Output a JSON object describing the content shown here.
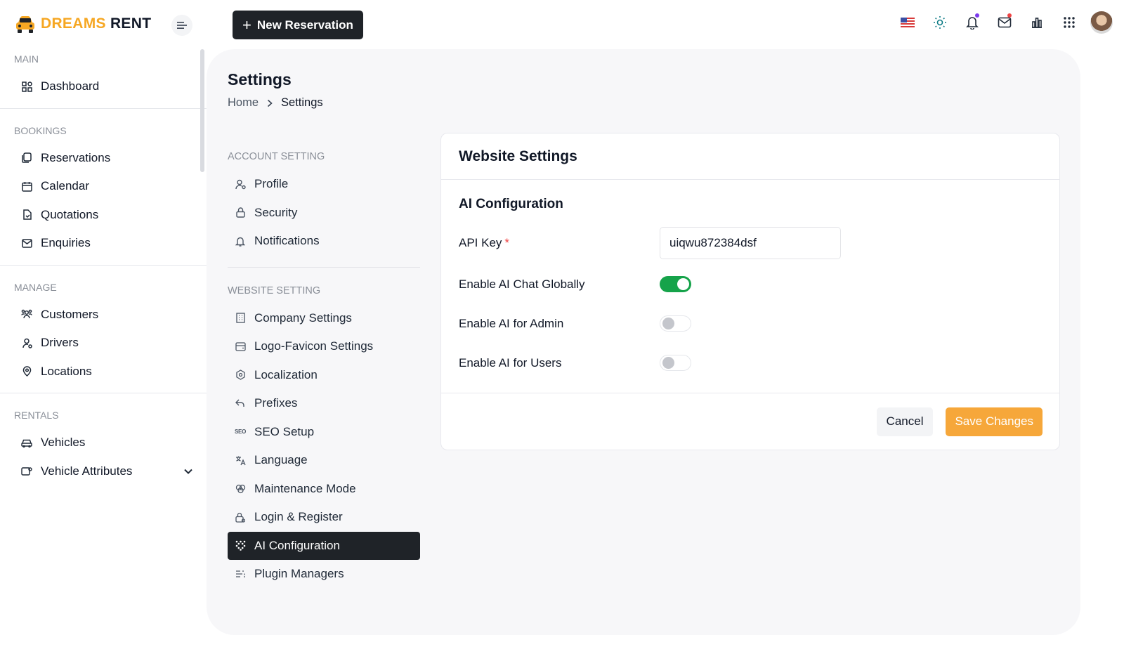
{
  "brand": {
    "name_part1": "DREAMS",
    "name_part2": "RENT",
    "accent": "#f6a723"
  },
  "header": {
    "new_reservation_label": "New Reservation",
    "icons": [
      "us-flag-icon",
      "sun-icon",
      "bell-icon",
      "mail-icon",
      "chart-icon",
      "apps-grid-icon",
      "user-avatar"
    ]
  },
  "sidebar": {
    "sections": [
      {
        "title": "MAIN",
        "items": [
          {
            "label": "Dashboard",
            "icon": "dashboard-icon"
          }
        ]
      },
      {
        "title": "BOOKINGS",
        "items": [
          {
            "label": "Reservations",
            "icon": "reservations-icon"
          },
          {
            "label": "Calendar",
            "icon": "calendar-icon"
          },
          {
            "label": "Quotations",
            "icon": "quotations-icon"
          },
          {
            "label": "Enquiries",
            "icon": "mail-icon"
          }
        ]
      },
      {
        "title": "MANAGE",
        "items": [
          {
            "label": "Customers",
            "icon": "customers-icon"
          },
          {
            "label": "Drivers",
            "icon": "driver-icon"
          },
          {
            "label": "Locations",
            "icon": "location-icon"
          }
        ]
      },
      {
        "title": "RENTALS",
        "items": [
          {
            "label": "Vehicles",
            "icon": "car-icon"
          },
          {
            "label": "Vehicle Attributes",
            "icon": "vehicle-attributes-icon"
          }
        ]
      }
    ]
  },
  "page": {
    "title": "Settings",
    "breadcrumb": {
      "home": "Home",
      "current": "Settings"
    }
  },
  "settings_nav": {
    "account_title": "ACCOUNT SETTING",
    "account_items": [
      {
        "label": "Profile",
        "icon": "profile-icon"
      },
      {
        "label": "Security",
        "icon": "lock-icon"
      },
      {
        "label": "Notifications",
        "icon": "bell-icon"
      }
    ],
    "website_title": "WEBSITE SETTING",
    "website_items": [
      {
        "label": "Company Settings",
        "icon": "building-icon"
      },
      {
        "label": "Logo-Favicon Settings",
        "icon": "image-icon"
      },
      {
        "label": "Localization",
        "icon": "hexagon-icon"
      },
      {
        "label": "Prefixes",
        "icon": "arrow-back-icon"
      },
      {
        "label": "SEO Setup",
        "icon": "seo-icon"
      },
      {
        "label": "Language",
        "icon": "language-icon"
      },
      {
        "label": "Maintenance Mode",
        "icon": "tools-icon"
      },
      {
        "label": "Login & Register",
        "icon": "login-lock-icon"
      },
      {
        "label": "AI Configuration",
        "icon": "ai-sparkle-icon"
      },
      {
        "label": "Plugin Managers",
        "icon": "plugin-icon"
      }
    ],
    "active": "AI Configuration"
  },
  "card": {
    "title": "Website Settings",
    "section_title": "AI Configuration",
    "api_key_label": "API Key",
    "api_key_required": "*",
    "api_key_value": "uiqwu872384dsf",
    "toggles": [
      {
        "label": "Enable AI Chat Globally",
        "on": true
      },
      {
        "label": "Enable AI for Admin",
        "on": false
      },
      {
        "label": "Enable AI for Users",
        "on": false
      }
    ],
    "cancel_label": "Cancel",
    "save_label": "Save Changes",
    "toggle_on_color": "#16a34a",
    "save_color": "#f6a73a"
  }
}
